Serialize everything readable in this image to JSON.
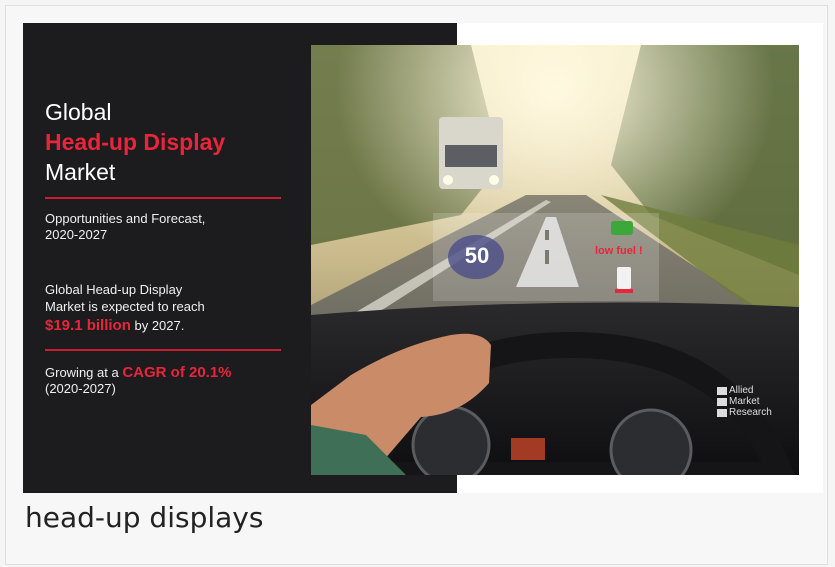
{
  "infographic": {
    "title_line1": "Global",
    "title_line2": "Head-up Display",
    "title_line3": "Market",
    "subtitle_line1": "Opportunities and Forecast,",
    "subtitle_line2": "2020-2027",
    "stat_line1": "Global Head-up Display",
    "stat_line2": "Market is expected to reach",
    "stat_value": "$19.1 billion",
    "stat_suffix": " by 2027.",
    "growth_prefix": "Growing at a ",
    "growth_value": "CAGR of 20.1%",
    "growth_period": "(2020-2027)"
  },
  "hud": {
    "speed": "50",
    "warning": "low fuel !"
  },
  "watermark": {
    "line1": "Allied",
    "line2": "Market",
    "line3": "Research"
  },
  "caption": "head-up displays",
  "colors": {
    "accent": "#e8253a",
    "panel": "#1c1c1e"
  }
}
